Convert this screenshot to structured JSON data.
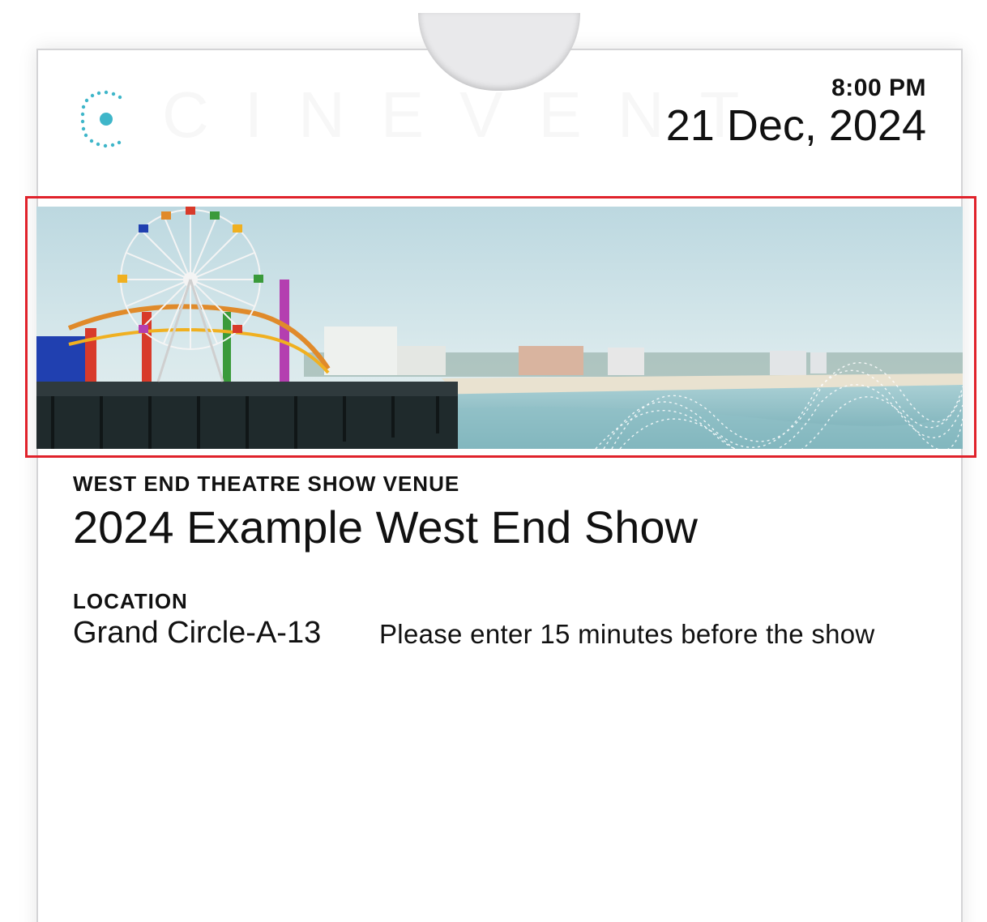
{
  "pass": {
    "logo_icon": "dotted-circle-logo-icon",
    "logo_text": "CINEVENT",
    "time": "8:00 PM",
    "date": "21 Dec, 2024",
    "banner_image": "santa-monica-pier-ferris-wheel-beach-image",
    "venue_label": "WEST END THEATRE SHOW VENUE",
    "show_title": "2024 Example West End Show",
    "location_label": "LOCATION",
    "location_value": "Grand Circle-A-13",
    "note": "Please enter 15 minutes before the show"
  },
  "colors": {
    "accent": "#3fb6c9",
    "highlight_frame": "#e0222b",
    "text": "#111111"
  }
}
